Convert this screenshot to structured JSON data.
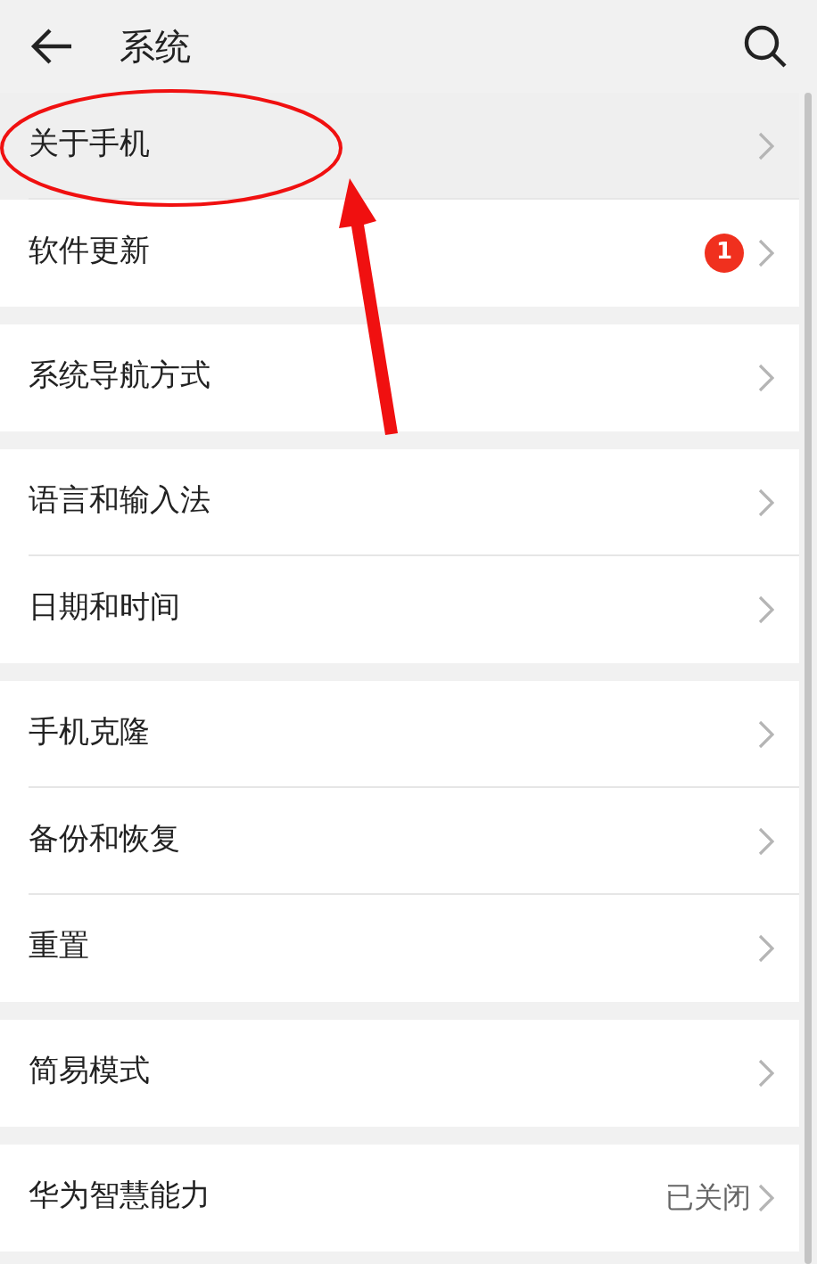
{
  "header": {
    "title": "系统"
  },
  "groups": [
    {
      "items": [
        {
          "label": "关于手机",
          "selected": true
        },
        {
          "label": "软件更新",
          "selected": false,
          "badge": "1"
        }
      ]
    },
    {
      "items": [
        {
          "label": "系统导航方式",
          "selected": false
        }
      ]
    },
    {
      "items": [
        {
          "label": "语言和输入法",
          "selected": false
        },
        {
          "label": "日期和时间",
          "selected": false
        }
      ]
    },
    {
      "items": [
        {
          "label": "手机克隆",
          "selected": false
        },
        {
          "label": "备份和恢复",
          "selected": false
        },
        {
          "label": "重置",
          "selected": false
        }
      ]
    },
    {
      "items": [
        {
          "label": "简易模式",
          "selected": false
        }
      ]
    },
    {
      "items": [
        {
          "label": "华为智慧能力",
          "selected": false,
          "value": "已关闭"
        }
      ]
    }
  ]
}
